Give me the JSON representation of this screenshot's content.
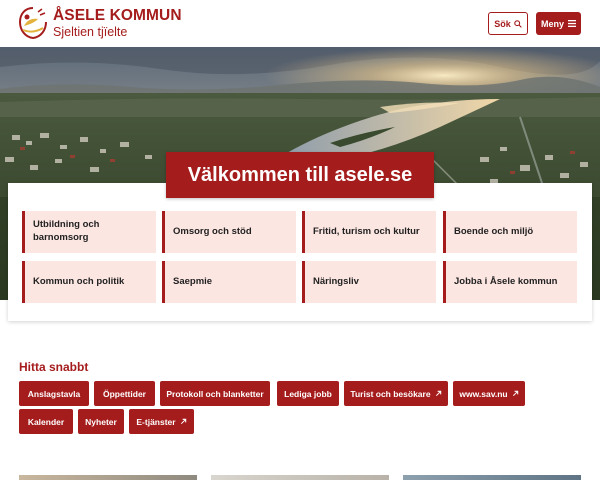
{
  "header": {
    "logo_name": "ÅSELE KOMMUN",
    "logo_sub": "Sjeltien tjïelte",
    "search_label": "Sök",
    "menu_label": "Meny"
  },
  "hero": {
    "welcome": "Välkommen till asele.se"
  },
  "tiles": [
    {
      "line1": "Utbildning och",
      "line2": "barnomsorg"
    },
    {
      "line1": "Omsorg och stöd"
    },
    {
      "line1": "Fritid, turism och kultur"
    },
    {
      "line1": "Boende och miljö"
    },
    {
      "line1": "Kommun och politik"
    },
    {
      "line1": "Saepmie"
    },
    {
      "line1": "Näringsliv"
    },
    {
      "line1": "Jobba i Åsele kommun"
    }
  ],
  "quick": {
    "title": "Hitta snabbt",
    "links": [
      {
        "label": "Anslagstavla"
      },
      {
        "label": "Öppettider"
      },
      {
        "label": "Protokoll och blanketter"
      },
      {
        "label": "Lediga jobb"
      },
      {
        "label": "Turist och besökare",
        "icon": "external-link-icon"
      },
      {
        "label": "www.sav.nu",
        "icon": "external-link-icon"
      },
      {
        "label": "Kalender"
      },
      {
        "label": "Nyheter"
      },
      {
        "label": "E-tjänster",
        "icon": "external-link-icon"
      }
    ]
  },
  "colors": {
    "brand": "#a51c1c",
    "tile_bg": "#fce6e2"
  }
}
